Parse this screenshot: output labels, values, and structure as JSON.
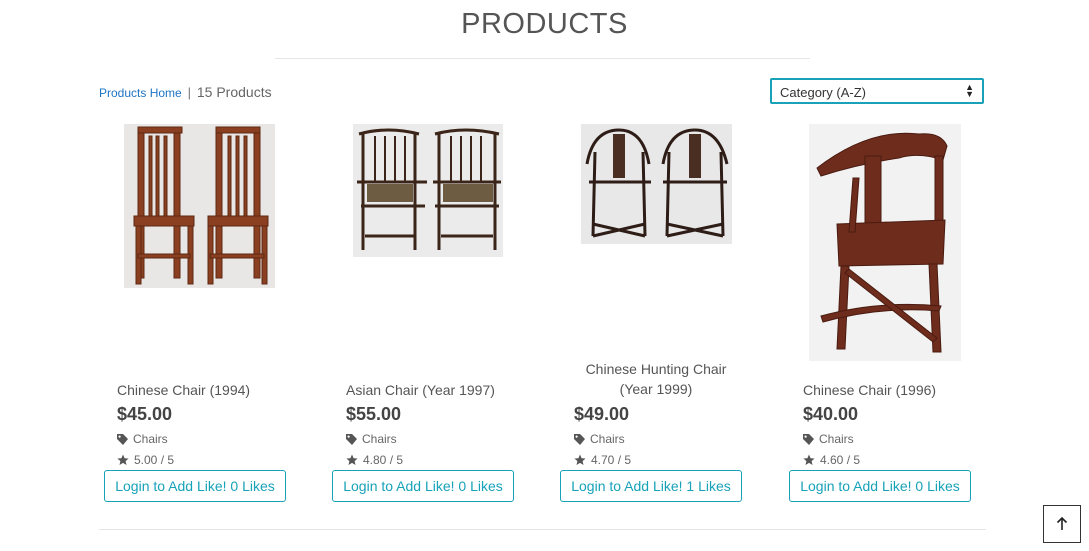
{
  "page": {
    "title": "PRODUCTS"
  },
  "breadcrumb": {
    "home_link": "Products Home",
    "separator": "|",
    "count_text": "15 Products"
  },
  "sort": {
    "selected": "Category (A-Z)"
  },
  "products": [
    {
      "name": "Chinese Chair (1994)",
      "price": "$45.00",
      "category": "Chairs",
      "rating": "5.00 / 5",
      "like_button": "Login to Add Like! 0 Likes"
    },
    {
      "name": "Asian Chair (Year 1997)",
      "price": "$55.00",
      "category": "Chairs",
      "rating": "4.80 / 5",
      "like_button": "Login to Add Like! 0 Likes"
    },
    {
      "name": "Chinese Hunting Chair (Year 1999)",
      "price": "$49.00",
      "category": "Chairs",
      "rating": "4.70 / 5",
      "like_button": "Login to Add Like! 1 Likes"
    },
    {
      "name": "Chinese Chair (1996)",
      "price": "$40.00",
      "category": "Chairs",
      "rating": "4.60 / 5",
      "like_button": "Login to Add Like! 0 Likes"
    }
  ],
  "colors": {
    "accent": "#17a2b8",
    "link": "#1f74c4",
    "wood": "#7a3b22"
  }
}
